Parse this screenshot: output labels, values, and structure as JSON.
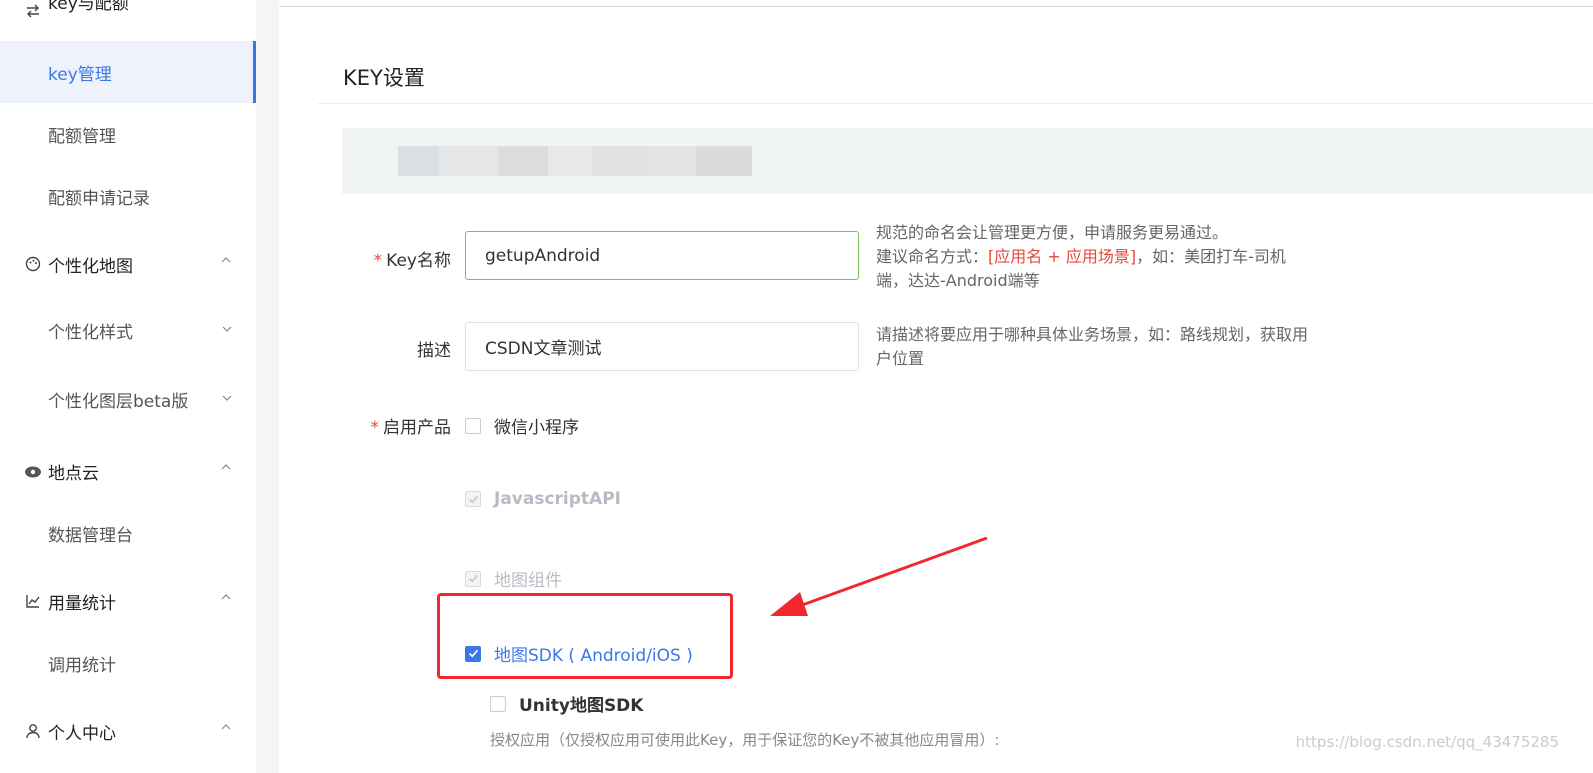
{
  "sidebar": {
    "group_key": {
      "label": "key与配额"
    },
    "items_key": [
      {
        "label": "key管理",
        "active": true
      },
      {
        "label": "配额管理"
      },
      {
        "label": "配额申请记录"
      }
    ],
    "group_custom_map": {
      "label": "个性化地图"
    },
    "items_custom_map": [
      {
        "label": "个性化样式"
      },
      {
        "label": "个性化图层beta版"
      }
    ],
    "group_place_cloud": {
      "label": "地点云"
    },
    "items_place_cloud": [
      {
        "label": "数据管理台"
      }
    ],
    "group_usage": {
      "label": "用量统计"
    },
    "items_usage": [
      {
        "label": "调用统计"
      }
    ],
    "group_user": {
      "label": "个人中心"
    }
  },
  "main": {
    "title": "KEY设置",
    "form": {
      "key_name_label": "Key名称",
      "key_name_value": "getupAndroid",
      "key_name_hint_1": "规范的命名会让管理更方便，申请服务更易通过。",
      "key_name_hint_2a": "建议命名方式：",
      "key_name_hint_2b": "[应用名 + 应用场景]",
      "key_name_hint_2c": "，如：美团打车-司机端，达达-Android端等",
      "desc_label": "描述",
      "desc_value": "CSDN文章测试",
      "desc_hint": "请描述将要应用于哪种具体业务场景，如：路线规划，获取用户位置",
      "products_label": "启用产品",
      "products": [
        {
          "label": "微信小程序",
          "checked": false,
          "disabled": false
        },
        {
          "label": "JavascriptAPI",
          "checked": true,
          "disabled": true
        },
        {
          "label": "地图组件",
          "checked": true,
          "disabled": true
        },
        {
          "label": "地图SDK ( Android/iOS )",
          "checked": true,
          "disabled": false
        },
        {
          "label": "Unity地图SDK",
          "checked": false,
          "disabled": false
        }
      ],
      "auth_text": "授权应用（仅授权应用可使用此Key，用于保证您的Key不被其他应用冒用）:"
    }
  },
  "watermark": "https://blog.csdn.net/qq_43475285",
  "colors": {
    "accent": "#3a78e8",
    "required": "#e8463c",
    "annotation": "#f0282d"
  }
}
